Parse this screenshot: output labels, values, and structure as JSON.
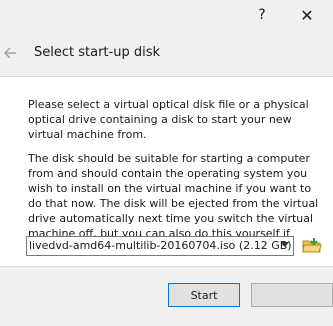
{
  "titlebar": {
    "help_label": "?",
    "close_label": "✕"
  },
  "header": {
    "back_icon": "back-arrow-icon",
    "title": "Select start-up disk"
  },
  "content": {
    "paragraph1": "Please select a virtual optical disk file or a physical optical drive containing a disk to start your new virtual machine from.",
    "paragraph2": "The disk should be suitable for starting a computer from and should contain the operating system you wish to install on the virtual machine if you want to do that now. The disk will be ejected from the virtual drive automatically next time you switch the virtual machine off, but you can also do this yourself if needed using the Devices menu.",
    "disk_select": {
      "selected_value": "livedvd-amd64-multilib-20160704.iso (2.12 GB)"
    },
    "folder_icon": "folder-open-icon"
  },
  "footer": {
    "start_label": "Start",
    "cancel_label": ""
  },
  "colors": {
    "accent": "#0078d7",
    "content_bg": "#ffffff",
    "chrome_bg": "#f0f0f0"
  }
}
